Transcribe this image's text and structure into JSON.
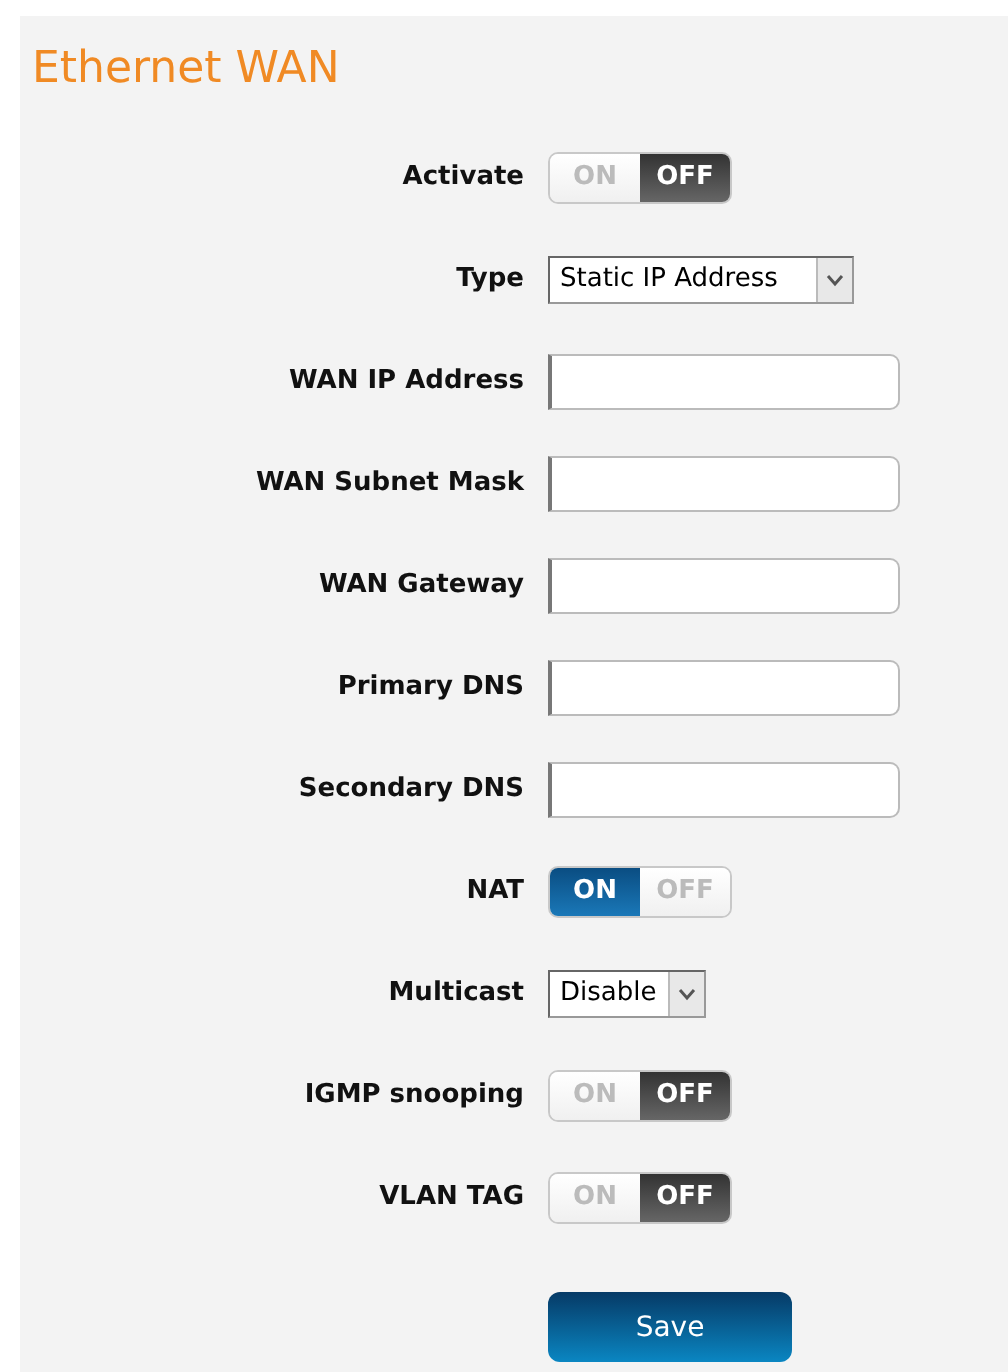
{
  "title": "Ethernet WAN",
  "fields": [
    {
      "kind": "toggle",
      "label": "Activate",
      "on": false,
      "on_text": "ON",
      "off_text": "OFF"
    },
    {
      "kind": "select",
      "label": "Type",
      "value": "Static IP Address"
    },
    {
      "kind": "text",
      "label": "WAN IP Address"
    },
    {
      "kind": "text",
      "label": "WAN Subnet Mask"
    },
    {
      "kind": "text",
      "label": "WAN Gateway"
    },
    {
      "kind": "text",
      "label": "Primary DNS"
    },
    {
      "kind": "text",
      "label": "Secondary DNS"
    },
    {
      "kind": "toggle",
      "label": "NAT",
      "on": true,
      "on_text": "ON",
      "off_text": "OFF"
    },
    {
      "kind": "select",
      "label": "Multicast",
      "value": "Disable"
    },
    {
      "kind": "toggle",
      "label": "IGMP snooping",
      "on": false,
      "on_text": "ON",
      "off_text": "OFF"
    },
    {
      "kind": "toggle",
      "label": "VLAN TAG",
      "on": false,
      "on_text": "ON",
      "off_text": "OFF"
    }
  ],
  "save_button": "Save"
}
